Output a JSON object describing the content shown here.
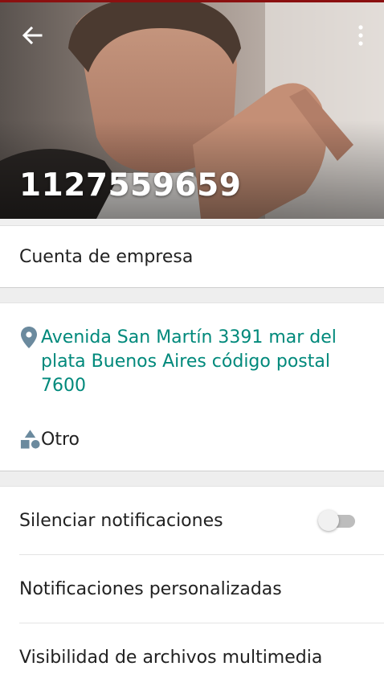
{
  "header": {
    "title": "1127559659",
    "back_icon": "arrow-back-icon",
    "menu_icon": "more-vert-icon",
    "accent_color": "#8b1010"
  },
  "business": {
    "label": "Cuenta de empresa"
  },
  "info": {
    "address": "Avenida San Martín 3391 mar del plata Buenos Aires código postal 7600",
    "address_icon": "location-pin-icon",
    "address_color": "#00897b",
    "category": "Otro",
    "category_icon": "category-shapes-icon"
  },
  "settings": {
    "mute_label": "Silenciar notificaciones",
    "mute_enabled": false,
    "custom_label": "Notificaciones personalizadas",
    "media_label": "Visibilidad de archivos multimedia"
  }
}
